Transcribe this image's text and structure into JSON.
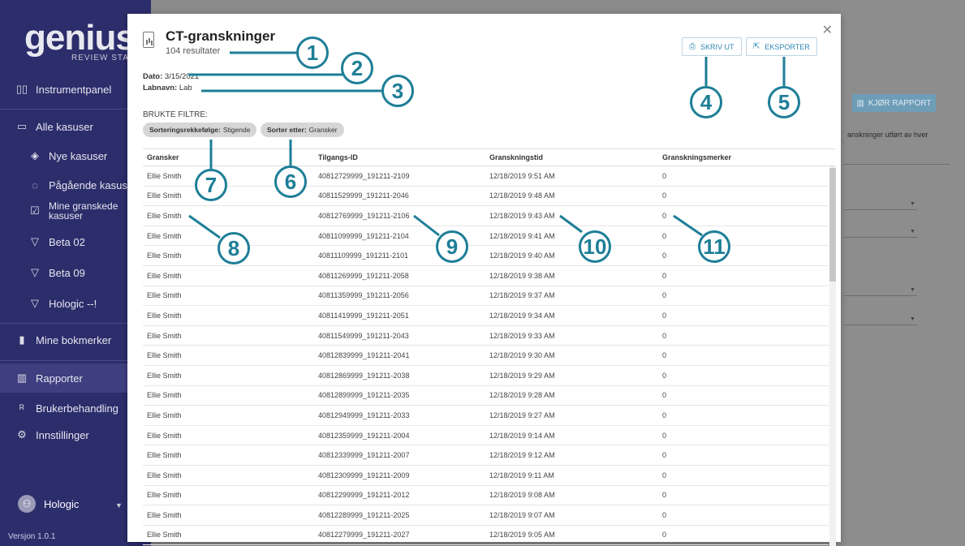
{
  "sidebar": {
    "logo": "genius",
    "logo_sub": "REVIEW STATIC",
    "items": [
      {
        "label": "Instrumentpanel",
        "icon": "dashboard-icon"
      },
      {
        "label": "Alle kasuser",
        "icon": "folder-icon"
      },
      {
        "label": "Nye kasuser",
        "icon": "tag-icon"
      },
      {
        "label": "Pågående kasuser",
        "icon": "spinner-icon"
      },
      {
        "label": "Mine granskede kasuser",
        "icon": "checkbox-icon"
      },
      {
        "label": "Beta 02",
        "icon": "filter-icon"
      },
      {
        "label": "Beta 09",
        "icon": "filter-icon"
      },
      {
        "label": "Hologic --!",
        "icon": "filter-icon"
      },
      {
        "label": "Mine bokmerker",
        "icon": "bookmark-icon"
      },
      {
        "label": "Rapporter",
        "icon": "report-icon"
      },
      {
        "label": "Brukerbehandling",
        "icon": "users-icon"
      },
      {
        "label": "Innstillinger",
        "icon": "gear-icon"
      }
    ],
    "user": "Hologic",
    "version": "Versjon 1.0.1"
  },
  "background": {
    "run_report_label": "KJØR RAPPORT",
    "description_fragment": "anskninger utført av hver"
  },
  "modal": {
    "title": "CT-granskninger",
    "result_count": "104 resultater",
    "date_label": "Dato:",
    "date_value": "3/15/2021",
    "lab_label": "Labnavn:",
    "lab_value": "Lab",
    "filters_label": "BRUKTE FILTRE:",
    "filters": [
      {
        "label": "Sorteringsrekkefølge:",
        "value": "Stigende"
      },
      {
        "label": "Sorter etter:",
        "value": "Gransker"
      }
    ],
    "print_label": "SKRIV UT",
    "export_label": "EKSPORTER",
    "columns": [
      "Gransker",
      "Tilgangs-ID",
      "Granskningstid",
      "Granskningsmerker"
    ],
    "rows": [
      [
        "Ellie Smith",
        "40812729999_191211-2109",
        "12/18/2019 9:51 AM",
        "0"
      ],
      [
        "Ellie Smith",
        "40811529999_191211-2046",
        "12/18/2019 9:48 AM",
        "0"
      ],
      [
        "Ellie Smith",
        "40812769999_191211-2106",
        "12/18/2019 9:43 AM",
        "0"
      ],
      [
        "Ellie Smith",
        "40811099999_191211-2104",
        "12/18/2019 9:41 AM",
        "0"
      ],
      [
        "Ellie Smith",
        "40811109999_191211-2101",
        "12/18/2019 9:40 AM",
        "0"
      ],
      [
        "Ellie Smith",
        "40811269999_191211-2058",
        "12/18/2019 9:38 AM",
        "0"
      ],
      [
        "Ellie Smith",
        "40811359999_191211-2056",
        "12/18/2019 9:37 AM",
        "0"
      ],
      [
        "Ellie Smith",
        "40811419999_191211-2051",
        "12/18/2019 9:34 AM",
        "0"
      ],
      [
        "Ellie Smith",
        "40811549999_191211-2043",
        "12/18/2019 9:33 AM",
        "0"
      ],
      [
        "Ellie Smith",
        "40812839999_191211-2041",
        "12/18/2019 9:30 AM",
        "0"
      ],
      [
        "Ellie Smith",
        "40812869999_191211-2038",
        "12/18/2019 9:29 AM",
        "0"
      ],
      [
        "Ellie Smith",
        "40812899999_191211-2035",
        "12/18/2019 9:28 AM",
        "0"
      ],
      [
        "Ellie Smith",
        "40812949999_191211-2033",
        "12/18/2019 9:27 AM",
        "0"
      ],
      [
        "Ellie Smith",
        "40812359999_191211-2004",
        "12/18/2019 9:14 AM",
        "0"
      ],
      [
        "Ellie Smith",
        "40812339999_191211-2007",
        "12/18/2019 9:12 AM",
        "0"
      ],
      [
        "Ellie Smith",
        "40812309999_191211-2009",
        "12/18/2019 9:11 AM",
        "0"
      ],
      [
        "Ellie Smith",
        "40812299999_191211-2012",
        "12/18/2019 9:08 AM",
        "0"
      ],
      [
        "Ellie Smith",
        "40812289999_191211-2025",
        "12/18/2019 9:07 AM",
        "0"
      ],
      [
        "Ellie Smith",
        "40812279999_191211-2027",
        "12/18/2019 9:05 AM",
        "0"
      ]
    ]
  },
  "callouts": [
    "1",
    "2",
    "3",
    "4",
    "5",
    "6",
    "7",
    "8",
    "9",
    "10",
    "11"
  ],
  "colors": {
    "sidebar_bg": "#2c2d6b",
    "accent": "#2d86b3",
    "callout": "#1e7e97"
  }
}
